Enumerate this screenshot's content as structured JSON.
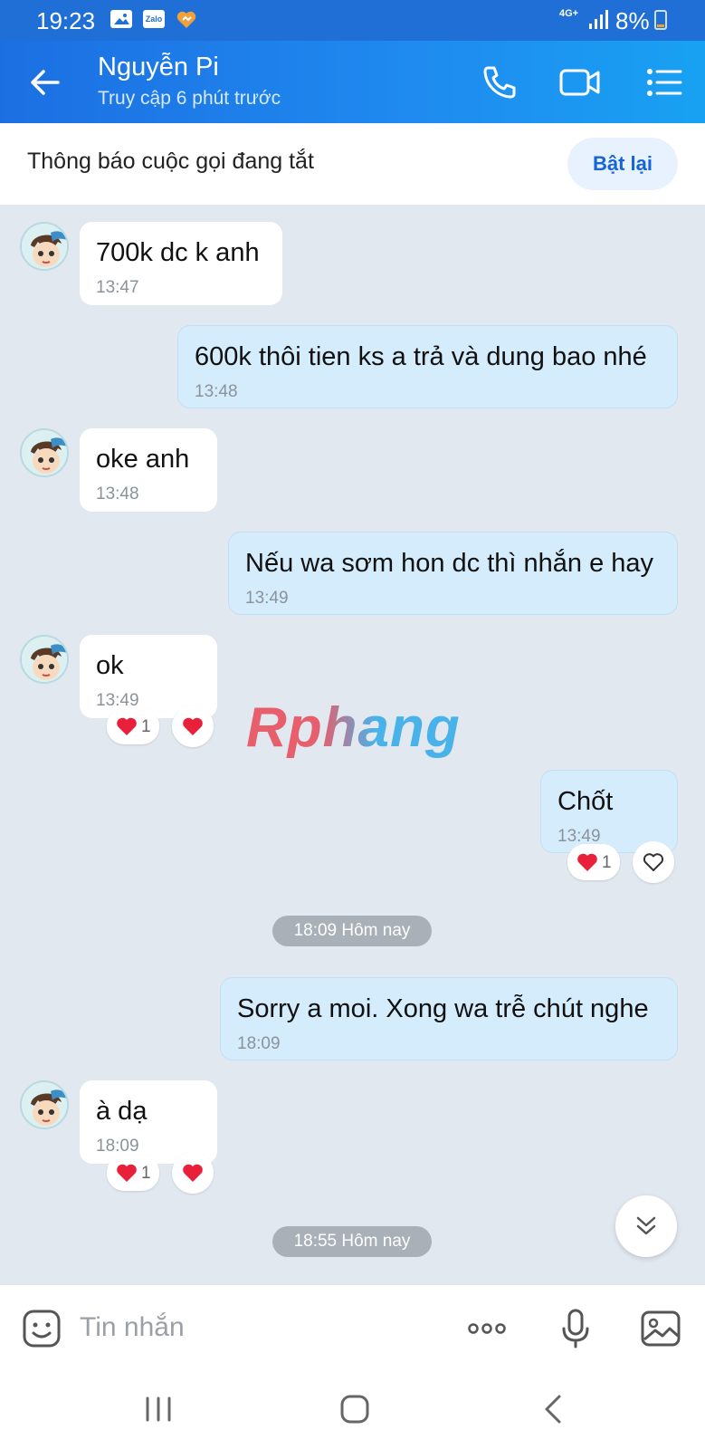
{
  "status_bar": {
    "time": "19:23",
    "app_badge": "Zalo",
    "network": "4G+",
    "battery": "8%"
  },
  "header": {
    "contact_name": "Nguyễn Pi",
    "last_seen": "Truy cập 6 phút trước"
  },
  "notice": {
    "text": "Thông báo cuộc gọi đang tắt",
    "button": "Bật lại"
  },
  "messages": [
    {
      "dir": "in",
      "text": "700k dc k anh",
      "time": "13:47"
    },
    {
      "dir": "out",
      "text": "600k thôi tien ks a trả và dung bao nhé",
      "time": "13:48"
    },
    {
      "dir": "in",
      "text": "oke anh",
      "time": "13:48"
    },
    {
      "dir": "out",
      "text": "Nếu wa sơm hon dc thì nhắn e hay",
      "time": "13:49"
    },
    {
      "dir": "in",
      "text": "ok",
      "time": "13:49",
      "reaction_count": "1"
    },
    {
      "dir": "out",
      "text": "Chốt",
      "time": "13:49",
      "reaction_count": "1"
    },
    {
      "dir": "out",
      "text": "Sorry a moi. Xong wa trễ chút nghe",
      "time": "18:09"
    },
    {
      "dir": "in",
      "text": "à dạ",
      "time": "18:09",
      "reaction_count": "1"
    }
  ],
  "dividers": [
    "18:09 Hôm nay",
    "18:55 Hôm nay"
  ],
  "watermark": "Rphang",
  "input": {
    "placeholder": "Tin nhắn"
  },
  "colors": {
    "header": "#1f8bf0",
    "outgoing_bubble": "#d5ecfc",
    "incoming_bubble": "#ffffff",
    "chat_bg": "#e2e8ef",
    "heart": "#e8203a"
  }
}
